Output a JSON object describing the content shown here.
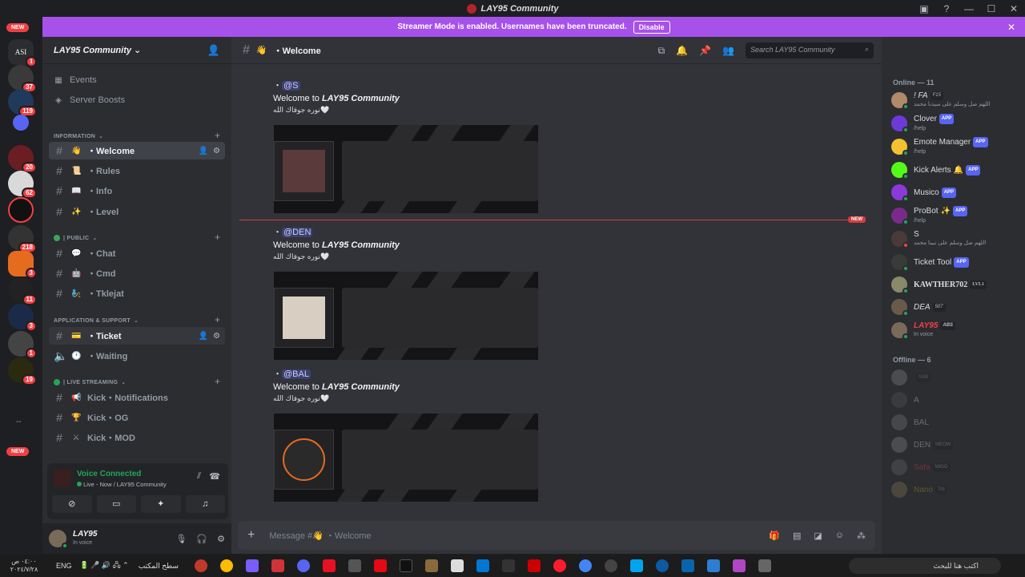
{
  "window": {
    "title": "LAY95 Community"
  },
  "streamer": {
    "message": "Streamer Mode is enabled. Usernames have been truncated.",
    "disable_label": "Disable"
  },
  "servers": {
    "new_top": "NEW",
    "new_bottom": "NEW",
    "asi_label": "ASI",
    "badges": [
      "1",
      "37",
      "119",
      "20",
      "62",
      "218",
      "3",
      "11",
      "3",
      "1",
      "19"
    ],
    "more": "--"
  },
  "guild": {
    "name": "LAY95 Community",
    "events": "Events",
    "boosts": "Server Boosts",
    "categories": {
      "information": "INFORMATION",
      "public": "| PUBLIC",
      "support": "APPLICATION & SUPPORT",
      "streaming": "| LIVE STREAMING"
    },
    "channels": [
      {
        "emoji": "👋",
        "name": "・Welcome"
      },
      {
        "emoji": "📜",
        "name": "・Rules"
      },
      {
        "emoji": "📖",
        "name": "・Info"
      },
      {
        "emoji": "✨",
        "name": "・Level"
      },
      {
        "emoji": "💬",
        "name": "・Chat"
      },
      {
        "emoji": "🤖",
        "name": "・Cmd"
      },
      {
        "emoji": "🧞",
        "name": "・Tklejat"
      },
      {
        "emoji": "💳",
        "name": "・Ticket"
      },
      {
        "emoji": "🕐",
        "name": "・Waiting"
      },
      {
        "emoji": "📢",
        "name": "Kick・Notifications"
      },
      {
        "emoji": "🏆",
        "name": "Kick・OG"
      },
      {
        "emoji": "⚔",
        "name": "Kick・MOD"
      }
    ]
  },
  "voice": {
    "status": "Voice Connected",
    "detail": "Live - Now / LAY95 Community"
  },
  "user": {
    "name": "LAY95",
    "status": "In voice"
  },
  "channel_header": {
    "name": "・Welcome",
    "search_placeholder": "Search LAY95 Community"
  },
  "messages": [
    {
      "mention": "@S",
      "prefix": "・",
      "welcome": "Welcome to",
      "brand": "LAY95 Community",
      "line3": "نوره جوفاك الله🤍"
    },
    {
      "mention": "@DEN",
      "prefix": "・",
      "welcome": "Welcome to",
      "brand": "LAY95 Community",
      "line3": "نوره جوفاك الله🤍"
    },
    {
      "mention": "@BAL",
      "prefix": "・",
      "welcome": "Welcome to",
      "brand": "LAY95 Community",
      "line3": "نوره جوفاك الله🤍"
    }
  ],
  "new_label": "NEW",
  "composer": {
    "placeholder": "Message #👋 ・Welcome",
    "plus": "+"
  },
  "members": {
    "online_header": "Online — 11",
    "offline_header": "Offline — 6",
    "online": [
      {
        "name": "! FA",
        "tag": "F15",
        "sub": "اللهم صل وسلم على سيدنا محمد",
        "app": ""
      },
      {
        "name": "Clover",
        "tag": "",
        "sub": "/help",
        "app": "APP"
      },
      {
        "name": "Emote Manager",
        "tag": "",
        "sub": "/help",
        "app": "APP"
      },
      {
        "name": "Kick Alerts",
        "tag": "",
        "sub": "",
        "app": "APP"
      },
      {
        "name": "Musico",
        "tag": "",
        "sub": "",
        "app": "APP"
      },
      {
        "name": "ProBot",
        "tag": "",
        "sub": "/help",
        "app": "APP"
      },
      {
        "name": "S",
        "tag": "",
        "sub": "اللهم صل وسلم على نبينا محمد",
        "app": ""
      },
      {
        "name": "Ticket Tool",
        "tag": "",
        "sub": "",
        "app": "APP"
      },
      {
        "name": "KAWTHER702",
        "tag": "LVL1",
        "sub": "",
        "app": ""
      },
      {
        "name": "DEA",
        "tag": "507",
        "sub": "",
        "app": ""
      },
      {
        "name": "LAY95",
        "tag": "ABS",
        "sub": "In voice",
        "app": ""
      }
    ],
    "offline": [
      {
        "name": "",
        "tag": "SXB"
      },
      {
        "name": "A",
        "tag": ""
      },
      {
        "name": "BAL",
        "tag": ""
      },
      {
        "name": "DEN",
        "tag": "MEOW"
      },
      {
        "name": "Safa",
        "tag": "MIGO"
      },
      {
        "name": "Nano",
        "tag": "7rb"
      }
    ]
  },
  "taskbar": {
    "time": "٠٤:٠٠ ص",
    "date": "٢٠٢٤/٧/٢٨",
    "lang": "ENG",
    "desktop": "سطح المكتب",
    "search": "اكتب هنا للبحث"
  },
  "colors": {
    "accent": "#5865f2",
    "streamer": "#a651ea",
    "online": "#23a559",
    "danger": "#f23f43"
  }
}
